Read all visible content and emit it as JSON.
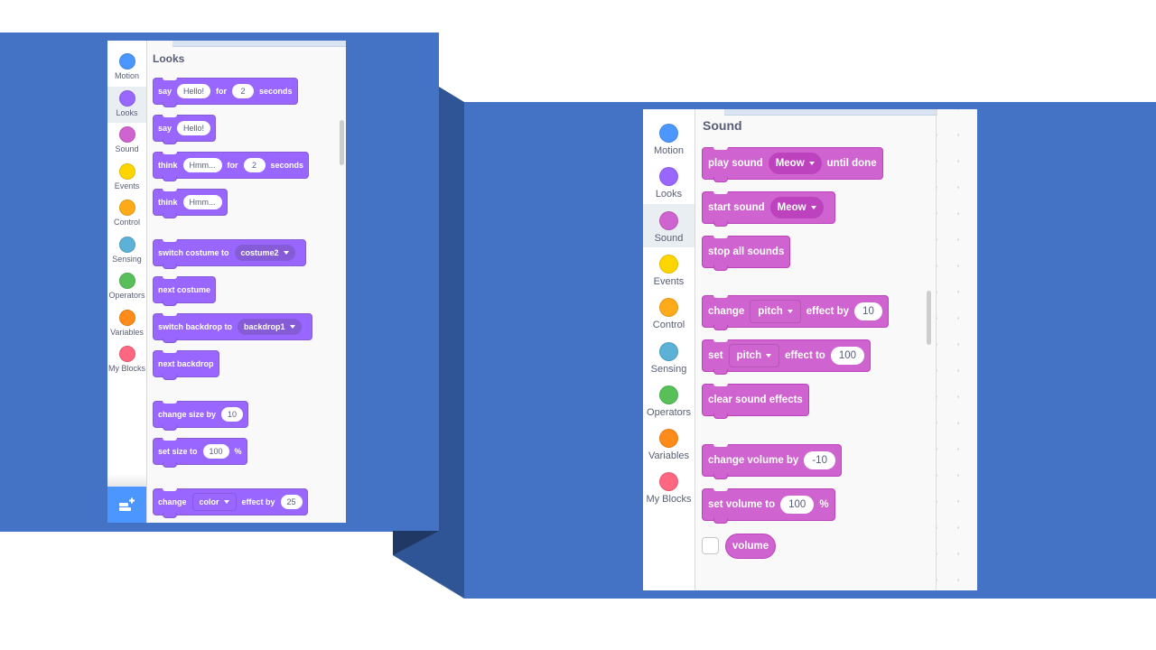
{
  "colors": {
    "slide_blue": "#4472c4",
    "connector_dark": "#2f5597",
    "connector_darker": "#203864",
    "looks": "#9966ff",
    "sound": "#cf63cf",
    "motion": "#4c97ff",
    "events": "#ffd500",
    "control": "#ffab19",
    "sensing": "#5cb1d6",
    "operators": "#59c059",
    "variables": "#ff8c1a",
    "my_blocks": "#ff6680"
  },
  "categories": [
    {
      "id": "motion",
      "label": "Motion",
      "color": "#4c97ff"
    },
    {
      "id": "looks",
      "label": "Looks",
      "color": "#9966ff"
    },
    {
      "id": "sound",
      "label": "Sound",
      "color": "#cf63cf"
    },
    {
      "id": "events",
      "label": "Events",
      "color": "#ffd500"
    },
    {
      "id": "control",
      "label": "Control",
      "color": "#ffab19"
    },
    {
      "id": "sensing",
      "label": "Sensing",
      "color": "#5cb1d6"
    },
    {
      "id": "operators",
      "label": "Operators",
      "color": "#59c059"
    },
    {
      "id": "variables",
      "label": "Variables",
      "color": "#ff8c1a"
    },
    {
      "id": "my_blocks",
      "label": "My Blocks",
      "color": "#ff6680"
    }
  ],
  "looks_panel": {
    "selected_category": "Looks",
    "title": "Looks",
    "extension_button": "add-extension-icon",
    "blocks": [
      {
        "parts": [
          {
            "t": "text",
            "v": "say"
          },
          {
            "t": "pill",
            "v": "Hello!"
          },
          {
            "t": "text",
            "v": "for"
          },
          {
            "t": "pill",
            "v": "2"
          },
          {
            "t": "text",
            "v": "seconds"
          }
        ]
      },
      {
        "parts": [
          {
            "t": "text",
            "v": "say"
          },
          {
            "t": "pill",
            "v": "Hello!"
          }
        ]
      },
      {
        "parts": [
          {
            "t": "text",
            "v": "think"
          },
          {
            "t": "pill",
            "v": "Hmm..."
          },
          {
            "t": "text",
            "v": "for"
          },
          {
            "t": "pill",
            "v": "2"
          },
          {
            "t": "text",
            "v": "seconds"
          }
        ]
      },
      {
        "parts": [
          {
            "t": "text",
            "v": "think"
          },
          {
            "t": "pill",
            "v": "Hmm..."
          }
        ]
      },
      {
        "parts": [
          {
            "t": "text",
            "v": "switch costume to"
          },
          {
            "t": "dropdown",
            "v": "costume2"
          }
        ]
      },
      {
        "parts": [
          {
            "t": "text",
            "v": "next costume"
          }
        ]
      },
      {
        "parts": [
          {
            "t": "text",
            "v": "switch backdrop to"
          },
          {
            "t": "dropdown",
            "v": "backdrop1"
          }
        ]
      },
      {
        "parts": [
          {
            "t": "text",
            "v": "next backdrop"
          }
        ]
      },
      {
        "parts": [
          {
            "t": "text",
            "v": "change size by"
          },
          {
            "t": "pill",
            "v": "10"
          }
        ]
      },
      {
        "parts": [
          {
            "t": "text",
            "v": "set size to"
          },
          {
            "t": "pill",
            "v": "100"
          },
          {
            "t": "text",
            "v": "%"
          }
        ]
      },
      {
        "parts": [
          {
            "t": "text",
            "v": "change"
          },
          {
            "t": "dropdown-square",
            "v": "color"
          },
          {
            "t": "text",
            "v": "effect by"
          },
          {
            "t": "pill",
            "v": "25"
          }
        ]
      }
    ]
  },
  "sound_panel": {
    "selected_category": "Sound",
    "title": "Sound",
    "blocks": [
      {
        "parts": [
          {
            "t": "text",
            "v": "play sound"
          },
          {
            "t": "dropdown",
            "v": "Meow"
          },
          {
            "t": "text",
            "v": "until done"
          }
        ]
      },
      {
        "parts": [
          {
            "t": "text",
            "v": "start sound"
          },
          {
            "t": "dropdown",
            "v": "Meow"
          }
        ]
      },
      {
        "parts": [
          {
            "t": "text",
            "v": "stop all sounds"
          }
        ]
      },
      {
        "parts": [
          {
            "t": "text",
            "v": "change"
          },
          {
            "t": "dropdown-square",
            "v": "pitch"
          },
          {
            "t": "text",
            "v": "effect by"
          },
          {
            "t": "pill",
            "v": "10"
          }
        ]
      },
      {
        "parts": [
          {
            "t": "text",
            "v": "set"
          },
          {
            "t": "dropdown-square",
            "v": "pitch"
          },
          {
            "t": "text",
            "v": "effect to"
          },
          {
            "t": "pill",
            "v": "100"
          }
        ]
      },
      {
        "parts": [
          {
            "t": "text",
            "v": "clear sound effects"
          }
        ]
      },
      {
        "parts": [
          {
            "t": "text",
            "v": "change volume by"
          },
          {
            "t": "pill",
            "v": "-10"
          }
        ]
      },
      {
        "parts": [
          {
            "t": "text",
            "v": "set volume to"
          },
          {
            "t": "pill",
            "v": "100"
          },
          {
            "t": "text",
            "v": "%"
          }
        ]
      }
    ],
    "reporter": {
      "label": "volume",
      "checked": false
    }
  }
}
